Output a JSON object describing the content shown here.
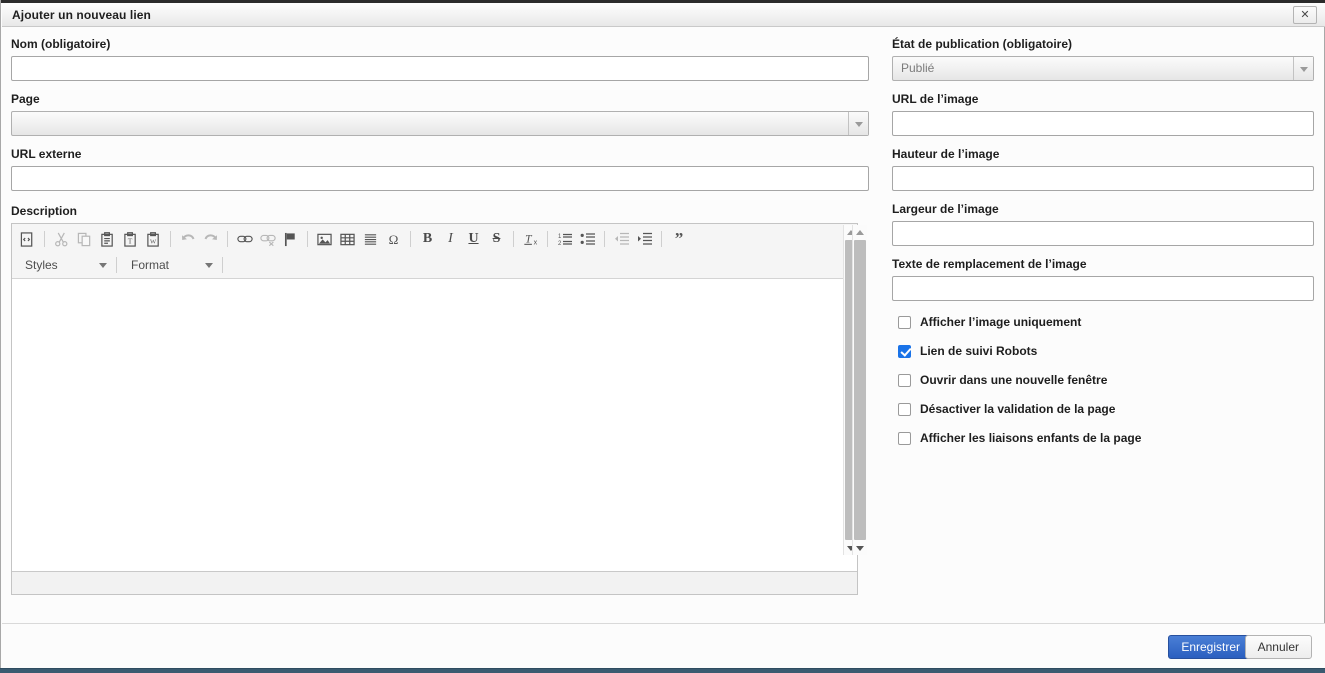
{
  "window": {
    "title": "Ajouter un nouveau lien",
    "close_label": "✕"
  },
  "left_column": {
    "name_label": "Nom (obligatoire)",
    "name_value": "",
    "name_placeholder": "",
    "page_label": "Page",
    "page_value": "",
    "external_url_label": "URL externe",
    "external_url_value": "",
    "external_url_placeholder": "",
    "description_label": "Description"
  },
  "editor": {
    "styles_label": "Styles",
    "format_label": "Format",
    "content": "",
    "toolbar_groups": [
      {
        "buttons": [
          {
            "name": "source-icon",
            "title": "Source",
            "disabled": false
          }
        ]
      },
      {
        "buttons": [
          {
            "name": "cut-icon",
            "title": "Couper",
            "disabled": true
          },
          {
            "name": "copy-icon",
            "title": "Copier",
            "disabled": true
          },
          {
            "name": "paste-icon",
            "title": "Coller",
            "disabled": false
          },
          {
            "name": "paste-as-text-icon",
            "title": "Coller comme texte brut",
            "disabled": false
          },
          {
            "name": "paste-from-word-icon",
            "title": "Coller depuis Word",
            "disabled": false
          }
        ]
      },
      {
        "buttons": [
          {
            "name": "undo-icon",
            "title": "Annuler",
            "disabled": true
          },
          {
            "name": "redo-icon",
            "title": "Rétablir",
            "disabled": true
          }
        ]
      },
      {
        "buttons": [
          {
            "name": "link-icon",
            "title": "Lien",
            "disabled": false
          },
          {
            "name": "unlink-icon",
            "title": "Supprimer le lien",
            "disabled": true
          },
          {
            "name": "anchor-icon",
            "title": "Ancre",
            "disabled": false
          }
        ]
      },
      {
        "buttons": [
          {
            "name": "image-icon",
            "title": "Image",
            "disabled": false
          },
          {
            "name": "table-icon",
            "title": "Tableau",
            "disabled": false
          },
          {
            "name": "horizontal-rule-icon",
            "title": "Ligne horizontale",
            "disabled": false
          },
          {
            "name": "special-character-icon",
            "title": "Caractère spécial",
            "disabled": false
          }
        ]
      },
      {
        "buttons": [
          {
            "name": "bold-icon",
            "title": "Gras",
            "disabled": false
          },
          {
            "name": "italic-icon",
            "title": "Italique",
            "disabled": false
          },
          {
            "name": "underline-icon",
            "title": "Souligné",
            "disabled": false
          },
          {
            "name": "strikethrough-icon",
            "title": "Barré",
            "disabled": false
          }
        ]
      },
      {
        "buttons": [
          {
            "name": "remove-format-icon",
            "title": "Supprimer la mise en forme",
            "disabled": false
          }
        ]
      },
      {
        "buttons": [
          {
            "name": "numbered-list-icon",
            "title": "Liste numérotée",
            "disabled": false
          },
          {
            "name": "bulleted-list-icon",
            "title": "Liste à puces",
            "disabled": false
          }
        ]
      },
      {
        "buttons": [
          {
            "name": "outdent-icon",
            "title": "Diminuer le retrait",
            "disabled": true
          },
          {
            "name": "indent-icon",
            "title": "Augmenter le retrait",
            "disabled": false
          }
        ]
      },
      {
        "buttons": [
          {
            "name": "blockquote-icon",
            "title": "Citation",
            "disabled": false
          }
        ]
      }
    ]
  },
  "right_column": {
    "publication_state_label": "État de publication (obligatoire)",
    "publication_state_value": "Publié",
    "image_url_label": "URL de l’image",
    "image_url_value": "",
    "image_height_label": "Hauteur de l’image",
    "image_height_value": "",
    "image_width_label": "Largeur de l’image",
    "image_width_value": "",
    "image_alt_label": "Texte de remplacement de l’image",
    "image_alt_value": "",
    "checkboxes": [
      {
        "label": "Afficher l’image uniquement",
        "checked": false,
        "name": "checkbox-show-image-only"
      },
      {
        "label": "Lien de suivi Robots",
        "checked": true,
        "name": "checkbox-robots-follow-link"
      },
      {
        "label": "Ouvrir dans une nouvelle fenêtre",
        "checked": false,
        "name": "checkbox-open-new-window"
      },
      {
        "label": "Désactiver la validation de la page",
        "checked": false,
        "name": "checkbox-disable-page-validation"
      },
      {
        "label": "Afficher les liaisons enfants de la page",
        "checked": false,
        "name": "checkbox-show-child-links"
      }
    ]
  },
  "footer": {
    "save_label": "Enregistrer",
    "cancel_label": "Annuler"
  },
  "colors": {
    "accent_blue": "#2b5fc0",
    "checkbox_blue": "#1a73e8",
    "bottom_bar": "#3a5a70"
  }
}
